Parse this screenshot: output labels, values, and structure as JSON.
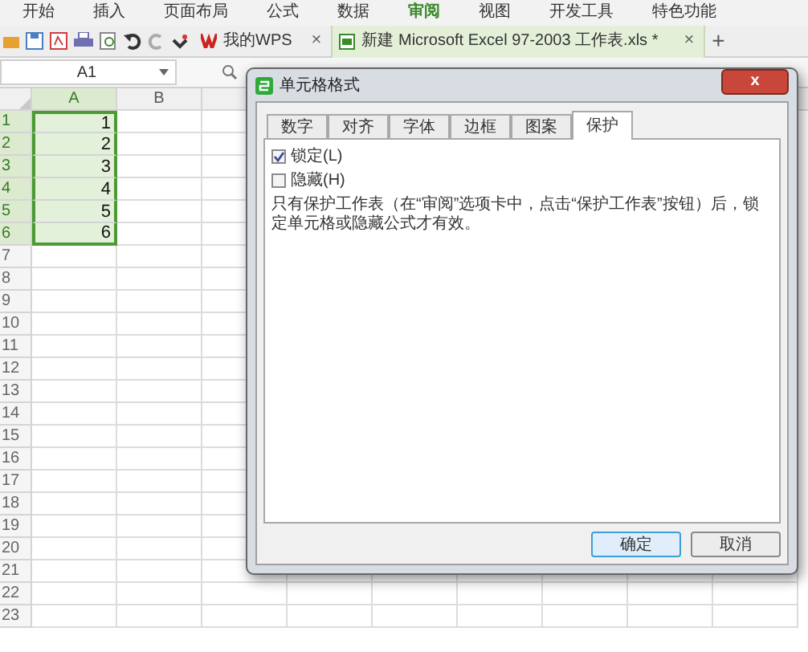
{
  "menu": [
    {
      "label": "开始",
      "selected": false
    },
    {
      "label": "插入",
      "selected": false
    },
    {
      "label": "页面布局",
      "selected": false
    },
    {
      "label": "公式",
      "selected": false
    },
    {
      "label": "数据",
      "selected": false
    },
    {
      "label": "审阅",
      "selected": true
    },
    {
      "label": "视图",
      "selected": false
    },
    {
      "label": "开发工具",
      "selected": false
    },
    {
      "label": "特色功能",
      "selected": false
    }
  ],
  "doc_tabs": [
    {
      "label": "我的WPS",
      "close": "×",
      "selected": false
    },
    {
      "label": "新建 Microsoft Excel 97-2003 工作表.xls *",
      "close": "×",
      "selected": true
    }
  ],
  "new_tab": "+",
  "name_box": "A1",
  "sheet": {
    "columns": [
      {
        "label": "A",
        "selected": true
      },
      {
        "label": "B",
        "selected": false
      }
    ],
    "rows": [
      {
        "label": "1",
        "selected": true,
        "cells": [
          "1"
        ]
      },
      {
        "label": "2",
        "selected": true,
        "cells": [
          "2"
        ]
      },
      {
        "label": "3",
        "selected": true,
        "cells": [
          "3"
        ]
      },
      {
        "label": "4",
        "selected": true,
        "cells": [
          "4"
        ]
      },
      {
        "label": "5",
        "selected": true,
        "cells": [
          "5"
        ]
      },
      {
        "label": "6",
        "selected": true,
        "cells": [
          "6"
        ]
      },
      {
        "label": "7",
        "selected": false,
        "cells": []
      },
      {
        "label": "8",
        "selected": false,
        "cells": []
      },
      {
        "label": "9",
        "selected": false,
        "cells": []
      },
      {
        "label": "10",
        "selected": false,
        "cells": []
      },
      {
        "label": "11",
        "selected": false,
        "cells": []
      },
      {
        "label": "12",
        "selected": false,
        "cells": []
      },
      {
        "label": "13",
        "selected": false,
        "cells": []
      },
      {
        "label": "14",
        "selected": false,
        "cells": []
      },
      {
        "label": "15",
        "selected": false,
        "cells": []
      },
      {
        "label": "16",
        "selected": false,
        "cells": []
      },
      {
        "label": "17",
        "selected": false,
        "cells": []
      },
      {
        "label": "18",
        "selected": false,
        "cells": []
      },
      {
        "label": "19",
        "selected": false,
        "cells": []
      },
      {
        "label": "20",
        "selected": false,
        "cells": []
      },
      {
        "label": "21",
        "selected": false,
        "cells": []
      },
      {
        "label": "22",
        "selected": false,
        "cells": []
      },
      {
        "label": "23",
        "selected": false,
        "cells": []
      }
    ]
  },
  "dialog": {
    "title": "单元格格式",
    "close": "x",
    "tabs": [
      {
        "label": "数字",
        "selected": false
      },
      {
        "label": "对齐",
        "selected": false
      },
      {
        "label": "字体",
        "selected": false
      },
      {
        "label": "边框",
        "selected": false
      },
      {
        "label": "图案",
        "selected": false
      },
      {
        "label": "保护",
        "selected": true
      }
    ],
    "options": [
      {
        "label": "锁定(L)",
        "checked": true
      },
      {
        "label": "隐藏(H)",
        "checked": false
      }
    ],
    "note": "只有保护工作表（在“审阅”选项卡中，点击“保护工作表”按钮）后，锁定单元格或隐藏公式才有效。",
    "buttons": [
      {
        "label": "确定",
        "selected": true
      },
      {
        "label": "取消",
        "selected": false
      }
    ]
  }
}
